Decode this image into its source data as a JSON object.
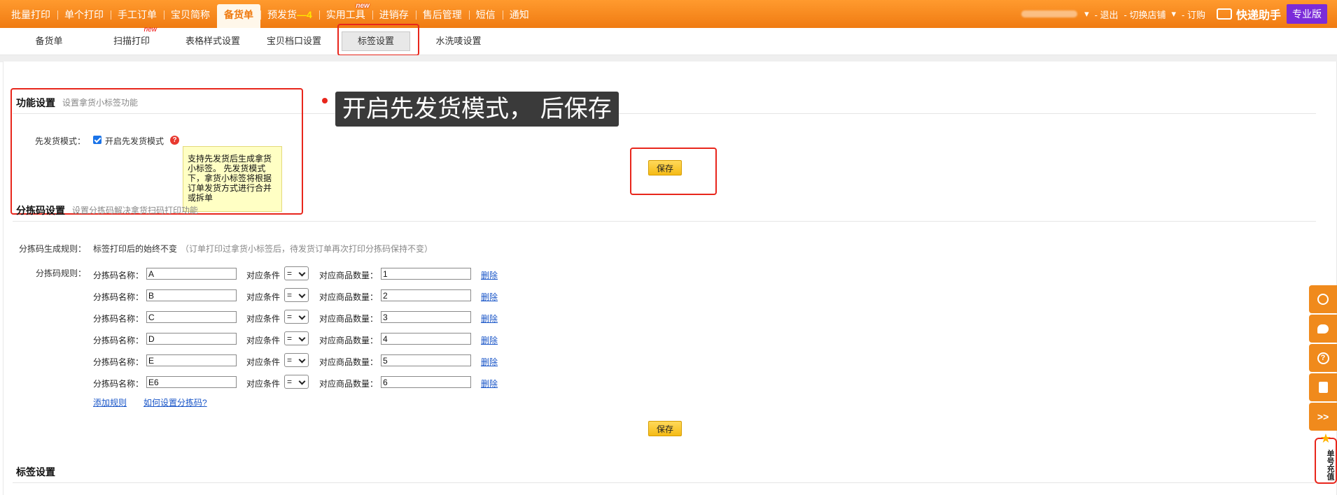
{
  "nav": {
    "items": [
      {
        "label": "批量打印"
      },
      {
        "label": "单个打印"
      },
      {
        "label": "手工订单"
      },
      {
        "label": "宝贝简称"
      },
      {
        "label": "备货单",
        "active": true
      },
      {
        "label": "预发货",
        "warn": "—4"
      },
      {
        "label": "实用工具",
        "badge": "new"
      },
      {
        "label": "进销存"
      },
      {
        "label": "售后管理"
      },
      {
        "label": "短信"
      },
      {
        "label": "通知"
      }
    ],
    "right": {
      "logout": "- 退出",
      "switch_store": "- 切换店铺",
      "order": "- 订购",
      "helper": "快递助手",
      "edition": "专业版"
    }
  },
  "subtabs": [
    {
      "label": "备货单"
    },
    {
      "label": "扫描打印",
      "badge": "new"
    },
    {
      "label": "表格样式设置"
    },
    {
      "label": "宝贝档口设置"
    },
    {
      "label": "标签设置",
      "active": true
    },
    {
      "label": "水洗唛设置"
    }
  ],
  "function_settings": {
    "title": "功能设置",
    "subtitle": "设置拿货小标签功能",
    "first_ship_label": "先发货模式：",
    "first_ship_checkbox": "开启先发货模式",
    "help": "?",
    "tooltip": "支持先发货后生成拿货小标签。 先发货模式下，拿货小标签将根据订单发货方式进行合并或拆单",
    "save": "保存"
  },
  "annotation": "开启先发货模式， 后保存",
  "sort_settings": {
    "title": "分拣码设置",
    "subtitle": "设置分拣码解决拿货扫码打印功能",
    "rule_label": "分拣码生成规则：",
    "rule_value": "标签打印后的始终不变",
    "rule_note": "（订单打印过拿货小标签后，待发货订单再次打印分拣码保持不变）",
    "rules_label": "分拣码规则：",
    "name_label": "分拣码名称：",
    "cond_label": "对应条件",
    "qty_label": "对应商品数量：",
    "delete": "删除",
    "rows": [
      {
        "name": "A",
        "cond": "=",
        "qty": "1"
      },
      {
        "name": "B",
        "cond": "=",
        "qty": "2"
      },
      {
        "name": "C",
        "cond": "=",
        "qty": "3"
      },
      {
        "name": "D",
        "cond": "=",
        "qty": "4"
      },
      {
        "name": "E",
        "cond": "=",
        "qty": "5"
      },
      {
        "name": "E6",
        "cond": "=",
        "qty": "6"
      }
    ],
    "add_rule": "添加规则",
    "how_to": "如何设置分拣码?",
    "save": "保存"
  },
  "label_settings": {
    "title": "标签设置"
  },
  "side": {
    "collapse": ">>",
    "recharge": "单号充值"
  },
  "colors": {
    "brand": "#f08a1c",
    "highlight": "#e8261c",
    "edition": "#7b2bd9"
  }
}
